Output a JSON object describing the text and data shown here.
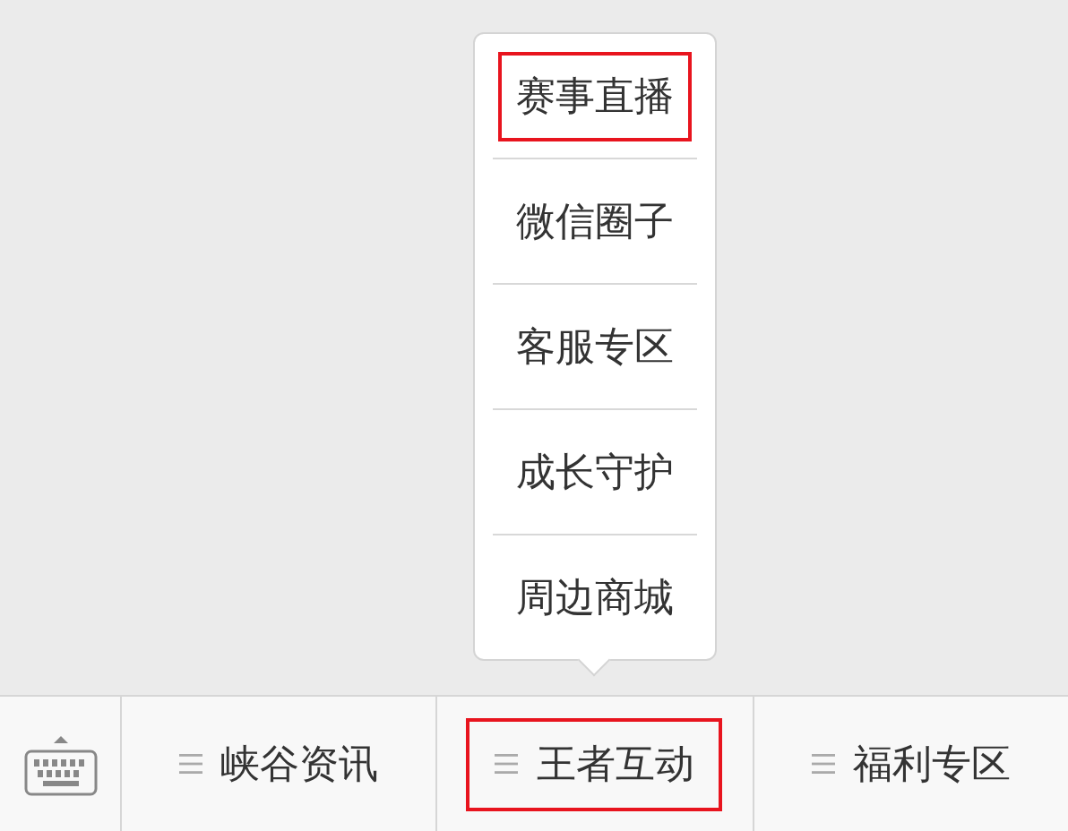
{
  "menu_bar": {
    "tabs": [
      {
        "label": "峡谷资讯",
        "highlighted": false
      },
      {
        "label": "王者互动",
        "highlighted": true,
        "submenu": [
          {
            "label": "赛事直播",
            "highlighted": true
          },
          {
            "label": "微信圈子",
            "highlighted": false
          },
          {
            "label": "客服专区",
            "highlighted": false
          },
          {
            "label": "成长守护",
            "highlighted": false
          },
          {
            "label": "周边商城",
            "highlighted": false
          }
        ]
      },
      {
        "label": "福利专区",
        "highlighted": false
      }
    ]
  }
}
